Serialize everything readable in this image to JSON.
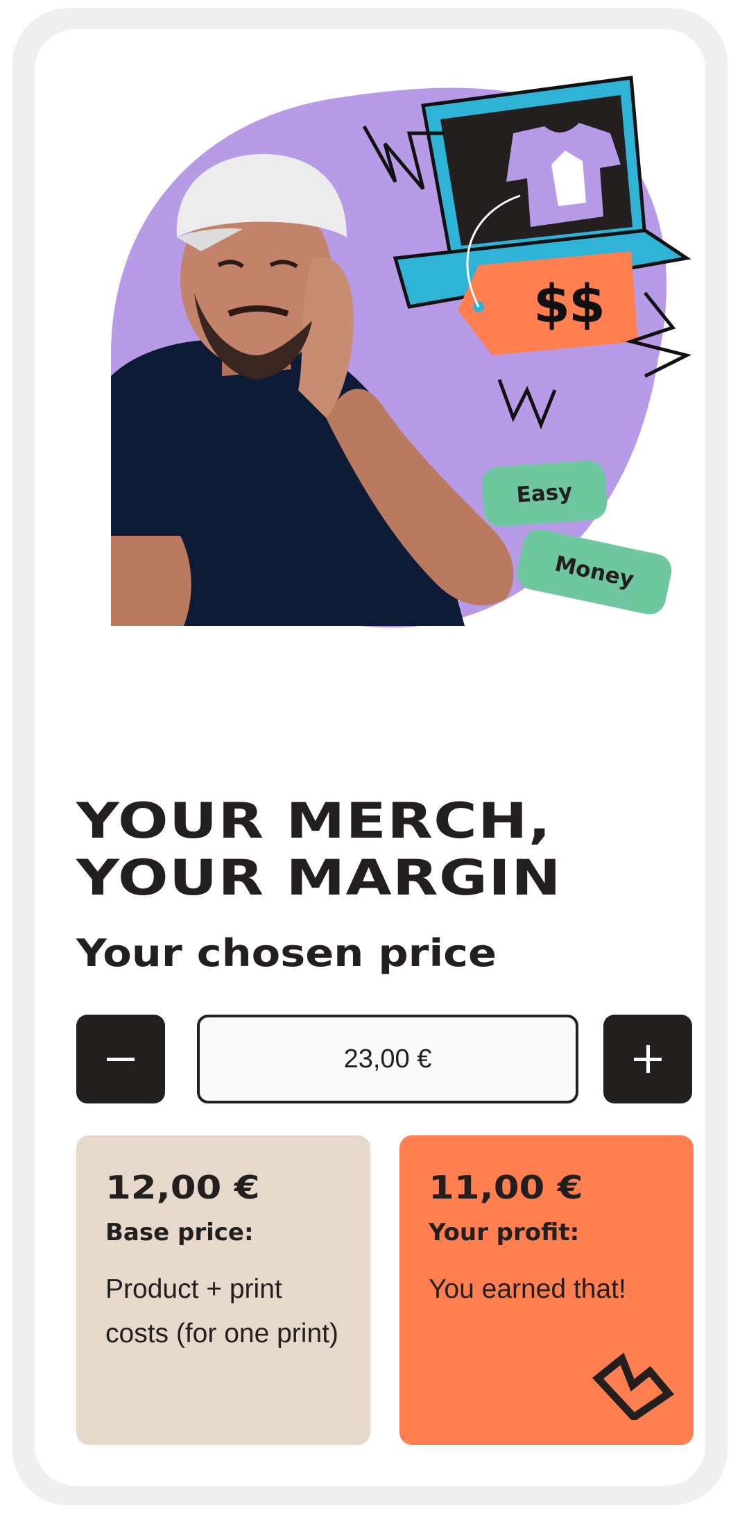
{
  "hero": {
    "price_tag": "$$",
    "tags": [
      "Easy",
      "Money"
    ]
  },
  "headline": [
    "YOUR MERCH,",
    "YOUR MARGIN"
  ],
  "subheading": "Your chosen price",
  "stepper": {
    "value": "23,00 €",
    "minus_icon": "minus-icon",
    "plus_icon": "plus-icon"
  },
  "breakdown": {
    "base": {
      "amount": "12,00 €",
      "title": "Base price:",
      "description": "Product + print costs (for one print)"
    },
    "profit": {
      "amount": "11,00 €",
      "title": "Your profit:",
      "description": "You earned that!",
      "icon": "lightning-icon"
    }
  },
  "colors": {
    "dark": "#231f1f",
    "purple": "#b89be6",
    "green_tag": "#6fc7a0",
    "orange": "#ff7f50",
    "beige": "#e6d8ca",
    "laptop_blue": "#2fb3d6"
  }
}
